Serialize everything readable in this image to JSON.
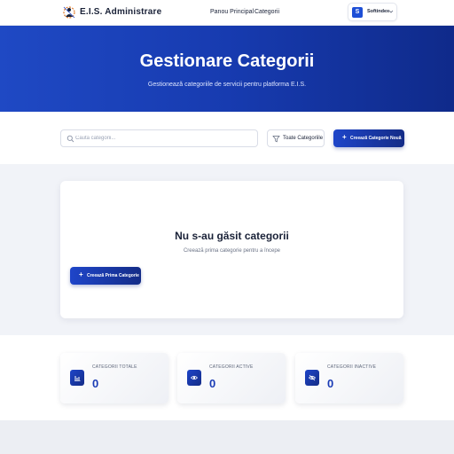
{
  "header": {
    "brand": "E.I.S. Administrare",
    "logo_icon": "gear-person-logo-icon",
    "nav": [
      {
        "label": "Panou Principal"
      },
      {
        "label": "Categorii"
      }
    ],
    "account": {
      "logo_letter": "S",
      "name": "Softindex",
      "icon": "chevron-down-icon"
    }
  },
  "hero": {
    "title": "Gestionare Categorii",
    "subtitle": "Gestionează categoriile de servicii pentru platforma E.I.S."
  },
  "toolbar": {
    "search_placeholder": "Caută categorii...",
    "search_value": "",
    "filter_label": "Toate Categoriile",
    "create_label": "Creează Categorie Nouă"
  },
  "empty_state": {
    "title": "Nu s-au găsit categorii",
    "subtitle": "Creează prima categorie pentru a începe",
    "button_label": "Creează Prima Categorie"
  },
  "stats": [
    {
      "label": "CATEGORII TOTALE",
      "value": "0",
      "icon": "bar-chart-icon"
    },
    {
      "label": "CATEGORII ACTIVE",
      "value": "0",
      "icon": "eye-icon"
    },
    {
      "label": "CATEGORII INACTIVE",
      "value": "0",
      "icon": "eye-off-icon"
    }
  ],
  "colors": {
    "accent": "#1e45c9",
    "accent_dark": "#142c87",
    "hero_start": "#1f49c4",
    "hero_end": "#0f2a8a"
  }
}
